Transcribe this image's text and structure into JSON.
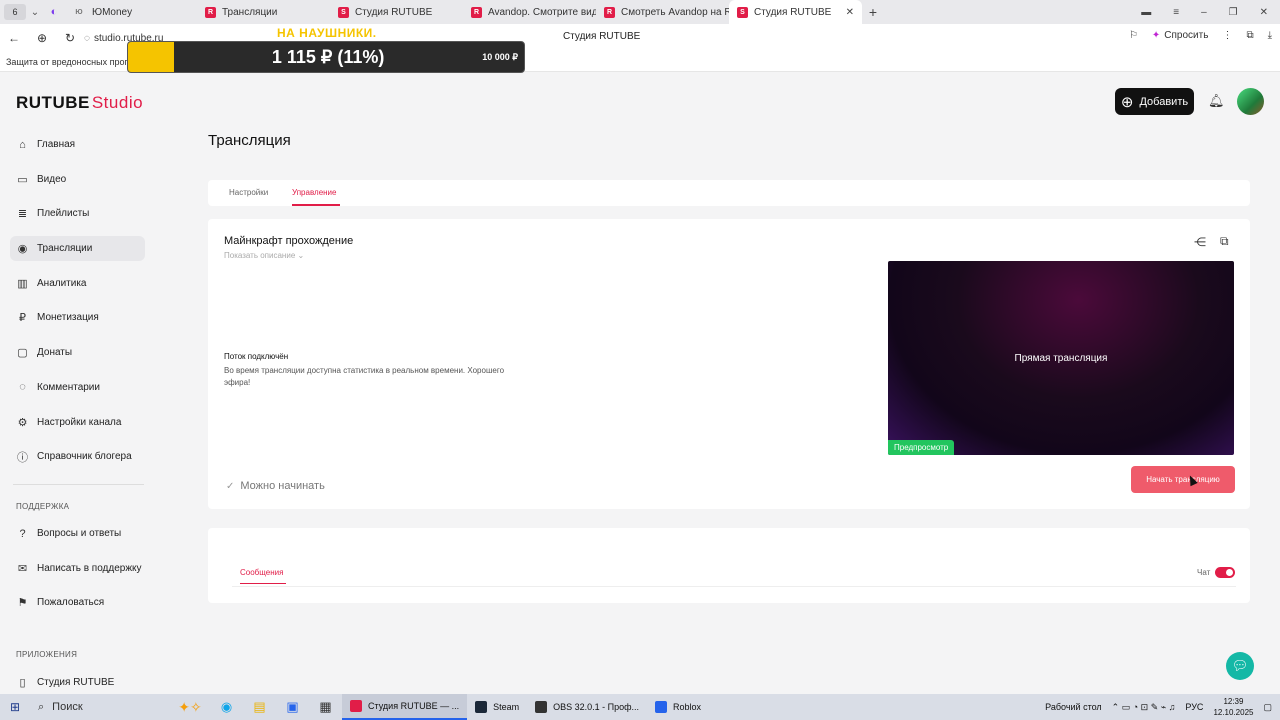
{
  "browser": {
    "tab_counter": "6",
    "tabs": [
      {
        "label": "ЮMoney",
        "active": false
      },
      {
        "label": "Трансляции",
        "active": false
      },
      {
        "label": "Студия RUTUBE",
        "active": false
      },
      {
        "label": "Avandop. Смотрите виде",
        "active": false
      },
      {
        "label": "Смотреть Avandop на RU",
        "active": false
      },
      {
        "label": "Студия RUTUBE",
        "active": true
      }
    ],
    "url": "studio.rutube.ru",
    "page_title": "Студия RUTUBE",
    "ask_label": "Спросить",
    "security_text": "Защита от вредоносных прогр"
  },
  "donation": {
    "title": "НА НАУШНИКИ.",
    "amount": "1 115 ₽ (11%)",
    "goal": "10 000 ₽",
    "progress_percent": 11
  },
  "header": {
    "logo_main": "RUTUBE",
    "logo_studio": "Studio",
    "add_label": "Добавить"
  },
  "sidebar": {
    "items": [
      {
        "label": "Главная",
        "icon": "home-icon",
        "glyph": "⌂"
      },
      {
        "label": "Видео",
        "icon": "video-icon",
        "glyph": "▭"
      },
      {
        "label": "Плейлисты",
        "icon": "playlist-icon",
        "glyph": "≣"
      },
      {
        "label": "Трансляции",
        "icon": "broadcast-icon",
        "glyph": "◉",
        "active": true
      },
      {
        "label": "Аналитика",
        "icon": "analytics-icon",
        "glyph": "▥"
      },
      {
        "label": "Монетизация",
        "icon": "ruble-icon",
        "glyph": "₽"
      },
      {
        "label": "Донаты",
        "icon": "donate-icon",
        "glyph": "▢"
      },
      {
        "label": "Комментарии",
        "icon": "comments-icon",
        "glyph": "◌"
      },
      {
        "label": "Настройки канала",
        "icon": "settings-icon",
        "glyph": "⚙"
      },
      {
        "label": "Справочник блогера",
        "icon": "handbook-icon",
        "glyph": "ⓘ"
      }
    ],
    "support_title": "ПОДДЕРЖКА",
    "support_items": [
      {
        "label": "Вопросы и ответы",
        "icon": "faq-icon",
        "glyph": "?"
      },
      {
        "label": "Написать в поддержку",
        "icon": "mail-icon",
        "glyph": "✉"
      },
      {
        "label": "Пожаловаться",
        "icon": "flag-icon",
        "glyph": "⚑"
      }
    ],
    "apps_title": "ПРИЛОЖЕНИЯ",
    "apps_item": "Студия RUTUBE"
  },
  "main": {
    "heading": "Трансляция",
    "tabs": [
      {
        "label": "Настройки",
        "active": false
      },
      {
        "label": "Управление",
        "active": true
      }
    ],
    "stream": {
      "title": "Майнкрафт прохождение",
      "show_description": "Показать описание",
      "connected_title": "Поток подключён",
      "connected_text": "Во время трансляции доступна статистика в реальном времени. Хорошего эфира!",
      "ready_text": "Можно начинать",
      "preview_label": "Прямая трансляция",
      "preview_badge": "Предпросмотр",
      "start_button": "Начать трансляцию"
    },
    "chat": {
      "tab_label": "Сообщения",
      "toggle_label": "Чат",
      "toggle_on": true
    }
  },
  "taskbar": {
    "search_label": "Поиск",
    "tasks": [
      {
        "label": "Студия RUTUBE — ...",
        "active": true,
        "color": "#e11d48"
      },
      {
        "label": "Steam",
        "active": false,
        "color": "#1b2838"
      },
      {
        "label": "OBS 32.0.1 - Проф...",
        "active": false,
        "color": "#333333"
      },
      {
        "label": "Roblox",
        "active": false,
        "color": "#2563eb"
      }
    ],
    "desktop_label": "Рабочий стол",
    "lang": "РУС",
    "time": "12:39",
    "date": "12.10.2025"
  },
  "colors": {
    "accent": "#e11d48",
    "start_button": "#ef5b6b",
    "preview_badge": "#22c55e",
    "donation_fill": "#f5c400"
  }
}
